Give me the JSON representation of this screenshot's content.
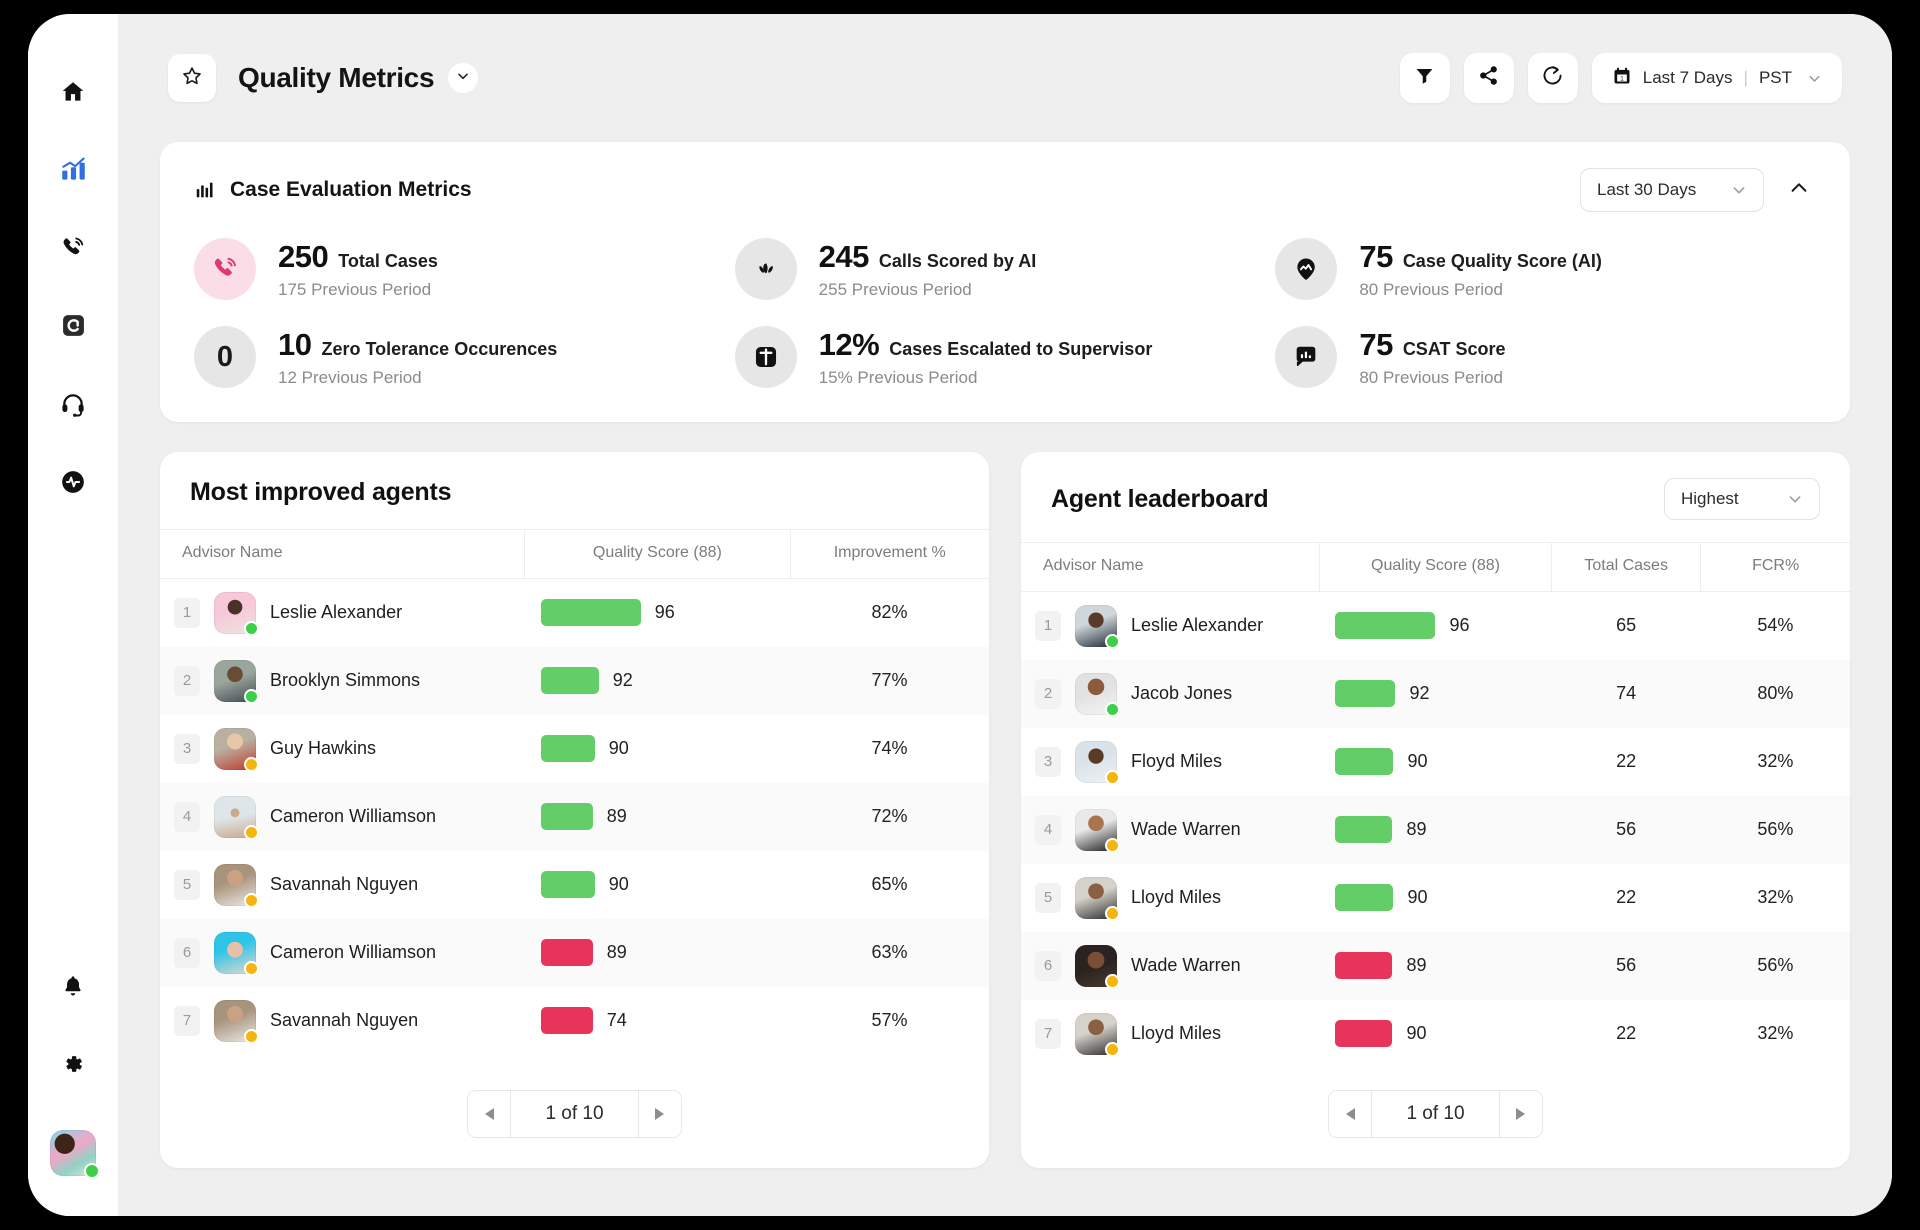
{
  "sidebar": {
    "items": [
      {
        "name": "home",
        "icon": "home-icon",
        "active": false
      },
      {
        "name": "analytics",
        "icon": "bar-chart-trend-icon",
        "active": true
      },
      {
        "name": "calls",
        "icon": "phone-ring-icon",
        "active": false
      },
      {
        "name": "contacts",
        "icon": "letter-c-square-icon",
        "active": false
      },
      {
        "name": "support",
        "icon": "headset-icon",
        "active": false
      },
      {
        "name": "activity",
        "icon": "pulse-circle-icon",
        "active": false
      }
    ],
    "bottom": [
      {
        "name": "notifications",
        "icon": "bell-icon"
      },
      {
        "name": "settings",
        "icon": "gear-icon"
      }
    ],
    "avatar_status": "online"
  },
  "topbar": {
    "star_icon": "star-outline-icon",
    "title": "Quality Metrics",
    "title_caret": "chevron-down-icon",
    "actions": [
      {
        "name": "filter",
        "icon": "funnel-icon"
      },
      {
        "name": "share",
        "icon": "share-nodes-icon"
      },
      {
        "name": "export",
        "icon": "share-arrow-circle-icon"
      }
    ],
    "date_range": "Last 7 Days",
    "separator": "|",
    "timezone": "PST",
    "calendar_icon": "calendar-icon",
    "date_caret": "chevron-down-icon"
  },
  "metrics_card": {
    "icon": "bar-chart-icon",
    "title": "Case Evaluation Metrics",
    "range_select": "Last 30 Days",
    "range_caret": "chevron-down-icon",
    "collapse_icon": "chevron-up-icon",
    "items": [
      {
        "icon": "phone-ring-icon",
        "icon_style": "pink",
        "value": "250",
        "label": "Total Cases",
        "previous": "175 Previous Period",
        "badge": ""
      },
      {
        "icon": "sparkle-leaf-icon",
        "icon_style": "grey",
        "value": "245",
        "label": "Calls Scored by AI",
        "previous": "255 Previous Period",
        "badge": ""
      },
      {
        "icon": "quality-pin-icon",
        "icon_style": "grey",
        "value": "75",
        "label": "Case Quality Score (AI)",
        "previous": "80 Previous Period",
        "badge": ""
      },
      {
        "icon": "zero-badge",
        "icon_style": "grey",
        "value": "10",
        "label": "Zero Tolerance Occurences",
        "previous": "12 Previous Period",
        "badge": "0"
      },
      {
        "icon": "transfer-square-icon",
        "icon_style": "grey",
        "value": "12%",
        "label": "Cases Escalated to Supervisor",
        "previous": "15% Previous Period",
        "badge": ""
      },
      {
        "icon": "chat-chart-icon",
        "icon_style": "grey",
        "value": "75",
        "label": "CSAT Score",
        "previous": "80 Previous Period",
        "badge": ""
      }
    ]
  },
  "colors": {
    "bar_good": "#63cd68",
    "bar_bad": "#e8345a",
    "accent_blue": "#2563eb",
    "status_online": "#3ecf4a",
    "status_away": "#f5b511",
    "metric_pink_bg": "#fbdde8"
  },
  "most_improved": {
    "title": "Most improved agents",
    "columns": [
      "Advisor Name",
      "Quality Score (88)",
      "Improvement %"
    ],
    "rows": [
      {
        "rank": "1",
        "name": "Leslie Alexander",
        "score": "96",
        "bar_pct": 100,
        "bar_tone": "good",
        "improvement": "82%",
        "status": "online",
        "av": "a1"
      },
      {
        "rank": "2",
        "name": "Brooklyn Simmons",
        "score": "92",
        "bar_pct": 58,
        "bar_tone": "good",
        "improvement": "77%",
        "status": "online",
        "av": "a2"
      },
      {
        "rank": "3",
        "name": "Guy Hawkins",
        "score": "90",
        "bar_pct": 54,
        "bar_tone": "good",
        "improvement": "74%",
        "status": "away",
        "av": "a3"
      },
      {
        "rank": "4",
        "name": "Cameron Williamson",
        "score": "89",
        "bar_pct": 52,
        "bar_tone": "good",
        "improvement": "72%",
        "status": "away",
        "av": "a4"
      },
      {
        "rank": "5",
        "name": "Savannah Nguyen",
        "score": "90",
        "bar_pct": 54,
        "bar_tone": "good",
        "improvement": "65%",
        "status": "away",
        "av": "a5"
      },
      {
        "rank": "6",
        "name": "Cameron Williamson",
        "score": "89",
        "bar_pct": 52,
        "bar_tone": "bad",
        "improvement": "63%",
        "status": "away",
        "av": "a6"
      },
      {
        "rank": "7",
        "name": "Savannah Nguyen",
        "score": "74",
        "bar_pct": 52,
        "bar_tone": "bad",
        "improvement": "57%",
        "status": "away",
        "av": "a5"
      }
    ],
    "pager": {
      "prev_icon": "triangle-left-icon",
      "label": "1 of 10",
      "next_icon": "triangle-right-icon"
    }
  },
  "leaderboard": {
    "title": "Agent leaderboard",
    "sort_select": "Highest",
    "sort_caret": "chevron-down-icon",
    "columns": [
      "Advisor Name",
      "Quality Score (88)",
      "Total Cases",
      "FCR%"
    ],
    "rows": [
      {
        "rank": "1",
        "name": "Leslie Alexander",
        "score": "96",
        "bar_pct": 100,
        "bar_tone": "good",
        "total_cases": "65",
        "fcr": "54%",
        "status": "online",
        "av": "b1"
      },
      {
        "rank": "2",
        "name": "Jacob Jones",
        "score": "92",
        "bar_pct": 60,
        "bar_tone": "good",
        "total_cases": "74",
        "fcr": "80%",
        "status": "online",
        "av": "b2"
      },
      {
        "rank": "3",
        "name": "Floyd Miles",
        "score": "90",
        "bar_pct": 58,
        "bar_tone": "good",
        "total_cases": "22",
        "fcr": "32%",
        "status": "away",
        "av": "b3"
      },
      {
        "rank": "4",
        "name": "Wade Warren",
        "score": "89",
        "bar_pct": 57,
        "bar_tone": "good",
        "total_cases": "56",
        "fcr": "56%",
        "status": "away",
        "av": "b4"
      },
      {
        "rank": "5",
        "name": "Lloyd Miles",
        "score": "90",
        "bar_pct": 58,
        "bar_tone": "good",
        "total_cases": "22",
        "fcr": "32%",
        "status": "away",
        "av": "b5"
      },
      {
        "rank": "6",
        "name": "Wade Warren",
        "score": "89",
        "bar_pct": 57,
        "bar_tone": "bad",
        "total_cases": "56",
        "fcr": "56%",
        "status": "away",
        "av": "b6"
      },
      {
        "rank": "7",
        "name": "Lloyd Miles",
        "score": "90",
        "bar_pct": 57,
        "bar_tone": "bad",
        "total_cases": "22",
        "fcr": "32%",
        "status": "away",
        "av": "b5"
      }
    ],
    "pager": {
      "prev_icon": "triangle-left-icon",
      "label": "1 of 10",
      "next_icon": "triangle-right-icon"
    }
  }
}
